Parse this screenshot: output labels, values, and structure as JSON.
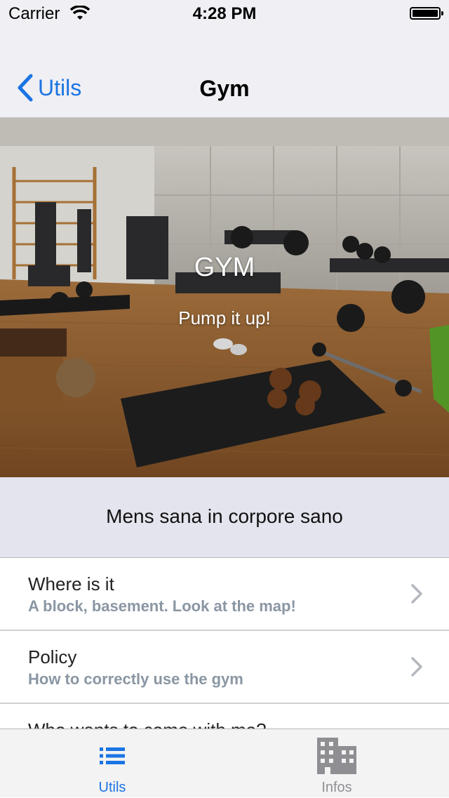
{
  "status_bar": {
    "carrier": "Carrier",
    "time": "4:28 PM"
  },
  "nav": {
    "back_label": "Utils",
    "title": "Gym"
  },
  "hero": {
    "title": "GYM",
    "subtitle": "Pump it up!"
  },
  "motto": "Mens sana in corpore sano",
  "list": {
    "rows": [
      {
        "title": "Where is it",
        "subtitle": "A block, basement. Look at the map!"
      },
      {
        "title": "Policy",
        "subtitle": "How to correctly use the gym"
      },
      {
        "title": "Who wants to come with me?",
        "subtitle": ""
      }
    ]
  },
  "tabs": [
    {
      "label": "Utils",
      "icon": "list-icon",
      "selected": true
    },
    {
      "label": "Infos",
      "icon": "building-icon",
      "selected": false
    }
  ],
  "colors": {
    "accent": "#1b74e4",
    "nav_background": "#efeff4",
    "motto_background": "#e4e4ee",
    "subtitle": "#8a96a3"
  }
}
